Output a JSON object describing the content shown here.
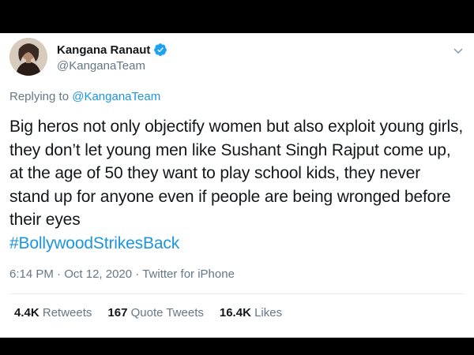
{
  "user": {
    "display_name": "Kangana Ranaut",
    "handle": "@KanganaTeam",
    "avatar_icon": "profile-photo",
    "verified_icon": "verified-badge-icon"
  },
  "reply": {
    "prefix": "Replying to ",
    "mention": "@KanganaTeam"
  },
  "tweet": {
    "text": "Big heros not only objectify women but also exploit young girls, they don’t let young men like Sushant Singh Rajput come up, at the age of 50 they want to play school kids, they never stand up for anyone even if people are being wronged before their eyes",
    "hashtag": "#BollywoodStrikesBack"
  },
  "meta": {
    "time": "6:14 PM",
    "separator1": " · ",
    "date": "Oct 12, 2020",
    "separator2": " · ",
    "source": "Twitter for iPhone"
  },
  "stats": {
    "retweets_count": "4.4K",
    "retweets_label": "Retweets",
    "quotes_count": "167",
    "quotes_label": "Quote Tweets",
    "likes_count": "16.4K",
    "likes_label": "Likes"
  },
  "colors": {
    "link": "#1b95e0",
    "muted": "#657786",
    "text": "#14171a",
    "frame": "#000000"
  }
}
